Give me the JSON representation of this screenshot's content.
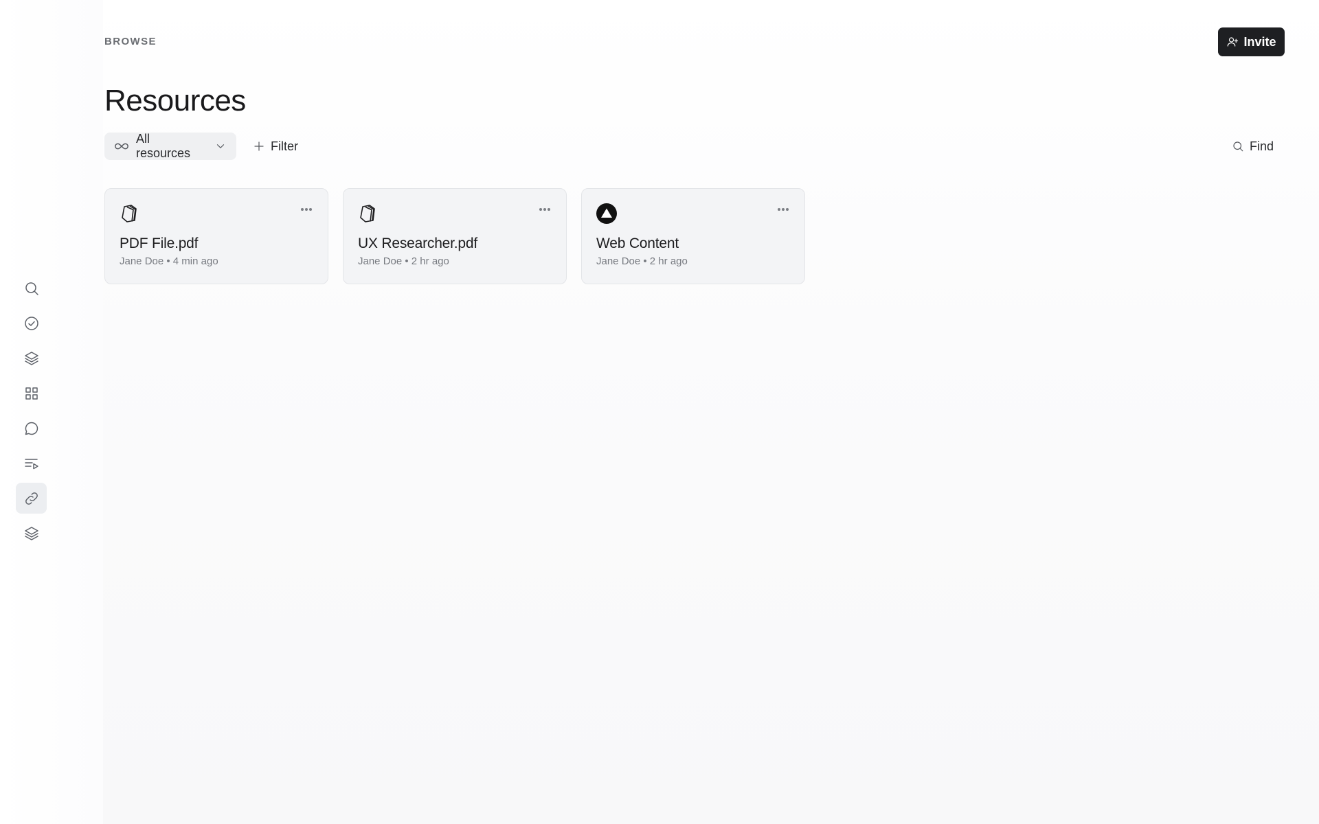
{
  "header": {
    "section": "BROWSE",
    "invite_label": "Invite",
    "title": "Resources"
  },
  "sidebar": {
    "items": [
      {
        "icon": "search-icon",
        "active": false
      },
      {
        "icon": "check-circle-icon",
        "active": false
      },
      {
        "icon": "layers-icon",
        "active": false
      },
      {
        "icon": "grid-icon",
        "active": false
      },
      {
        "icon": "chat-bubble-icon",
        "active": false
      },
      {
        "icon": "playlist-icon",
        "active": false
      },
      {
        "icon": "link-icon",
        "active": true
      },
      {
        "icon": "layers-icon",
        "active": false
      }
    ]
  },
  "toolbar": {
    "scope_label": "All resources",
    "filter_label": "Filter",
    "find_label": "Find"
  },
  "resources": [
    {
      "title": "PDF File.pdf",
      "author": "Jane Doe",
      "time": "4 min ago",
      "meta": "Jane Doe • 4 min ago",
      "icon": "pdf-stack-icon"
    },
    {
      "title": "UX Researcher.pdf",
      "author": "Jane Doe",
      "time": "2 hr ago",
      "meta": "Jane Doe • 2 hr ago",
      "icon": "pdf-stack-icon"
    },
    {
      "title": "Web Content",
      "author": "Jane Doe",
      "time": "2 hr ago",
      "meta": "Jane Doe • 2 hr ago",
      "icon": "web-triangle-icon"
    }
  ],
  "colors": {
    "primary_button": "#1e1f22",
    "card_background": "#f3f4f6",
    "active_nav": "#eceef1"
  }
}
